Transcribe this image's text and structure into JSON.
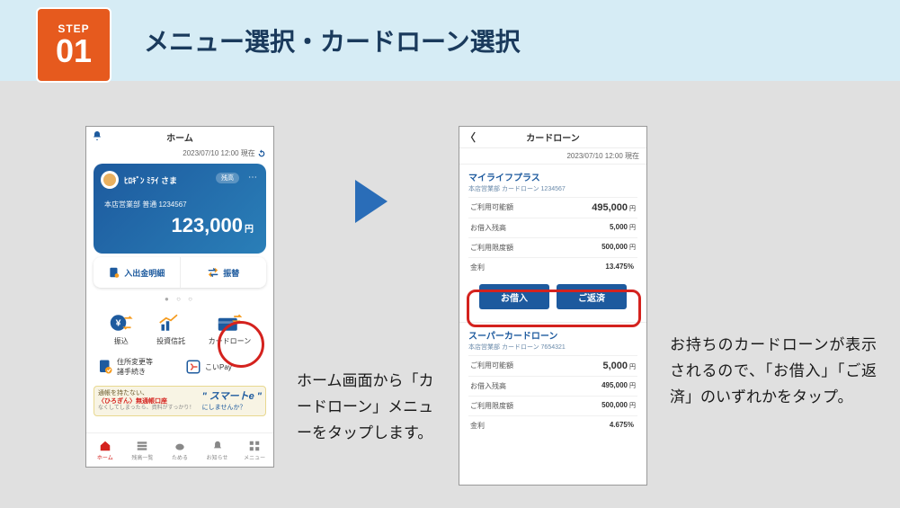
{
  "header": {
    "step_label": "STEP",
    "step_num": "01",
    "title": "メニュー選択・カードローン選択"
  },
  "phone1": {
    "title": "ホーム",
    "timestamp": "2023/07/10 12:00  現在",
    "user_name": "ﾋﾛｷﾞﾝ ﾐﾗｲ さま",
    "badge": "残高",
    "more": "⋯",
    "account_line": "本店営業部 普通 1234567",
    "balance": "123,000",
    "balance_unit": "円",
    "action_statement": "入出金明細",
    "action_transfer": "振替",
    "icons": {
      "remit": "振込",
      "invest": "投資信託",
      "cardloan": "カードローン"
    },
    "row2": {
      "address": "住所変更等\n諸手続き",
      "koipay": "こいPay"
    },
    "promo": {
      "line1": "通帳を持たない、",
      "line2": "〈ひろぎん〉無通帳口座",
      "smarte": "\" スマートe \"",
      "right": "にしませんか？",
      "small": "なくしてしまったら、資料がすっかり！"
    },
    "tabs": {
      "home": "ホーム",
      "balance": "残高一覧",
      "save": "ためる",
      "notice": "お知らせ",
      "menu": "メニュー"
    }
  },
  "phone2": {
    "title": "カードローン",
    "timestamp": "2023/07/10 12:00  現在",
    "card1": {
      "title": "マイライフプラス",
      "sub": "本店営業部 カードローン 1234567",
      "rows": [
        {
          "label": "ご利用可能額",
          "value": "495,000",
          "unit": "円",
          "big": true
        },
        {
          "label": "お借入残高",
          "value": "5,000",
          "unit": "円"
        },
        {
          "label": "ご利用限度額",
          "value": "500,000",
          "unit": "円"
        },
        {
          "label": "金利",
          "value": "13.475%",
          "unit": ""
        }
      ],
      "btn_borrow": "お借入",
      "btn_repay": "ご返済"
    },
    "card2": {
      "title": "スーパーカードローン",
      "sub": "本店営業部 カードローン 7654321",
      "rows": [
        {
          "label": "ご利用可能額",
          "value": "5,000",
          "unit": "円",
          "big": true
        },
        {
          "label": "お借入残高",
          "value": "495,000",
          "unit": "円"
        },
        {
          "label": "ご利用限度額",
          "value": "500,000",
          "unit": "円"
        },
        {
          "label": "金利",
          "value": "4.675%",
          "unit": ""
        }
      ]
    }
  },
  "captions": {
    "c1": "ホーム画面から「カードローン」メニューをタップします。",
    "c2": "お持ちのカードローンが表示されるので、「お借入」「ご返済」のいずれかをタップ。"
  }
}
